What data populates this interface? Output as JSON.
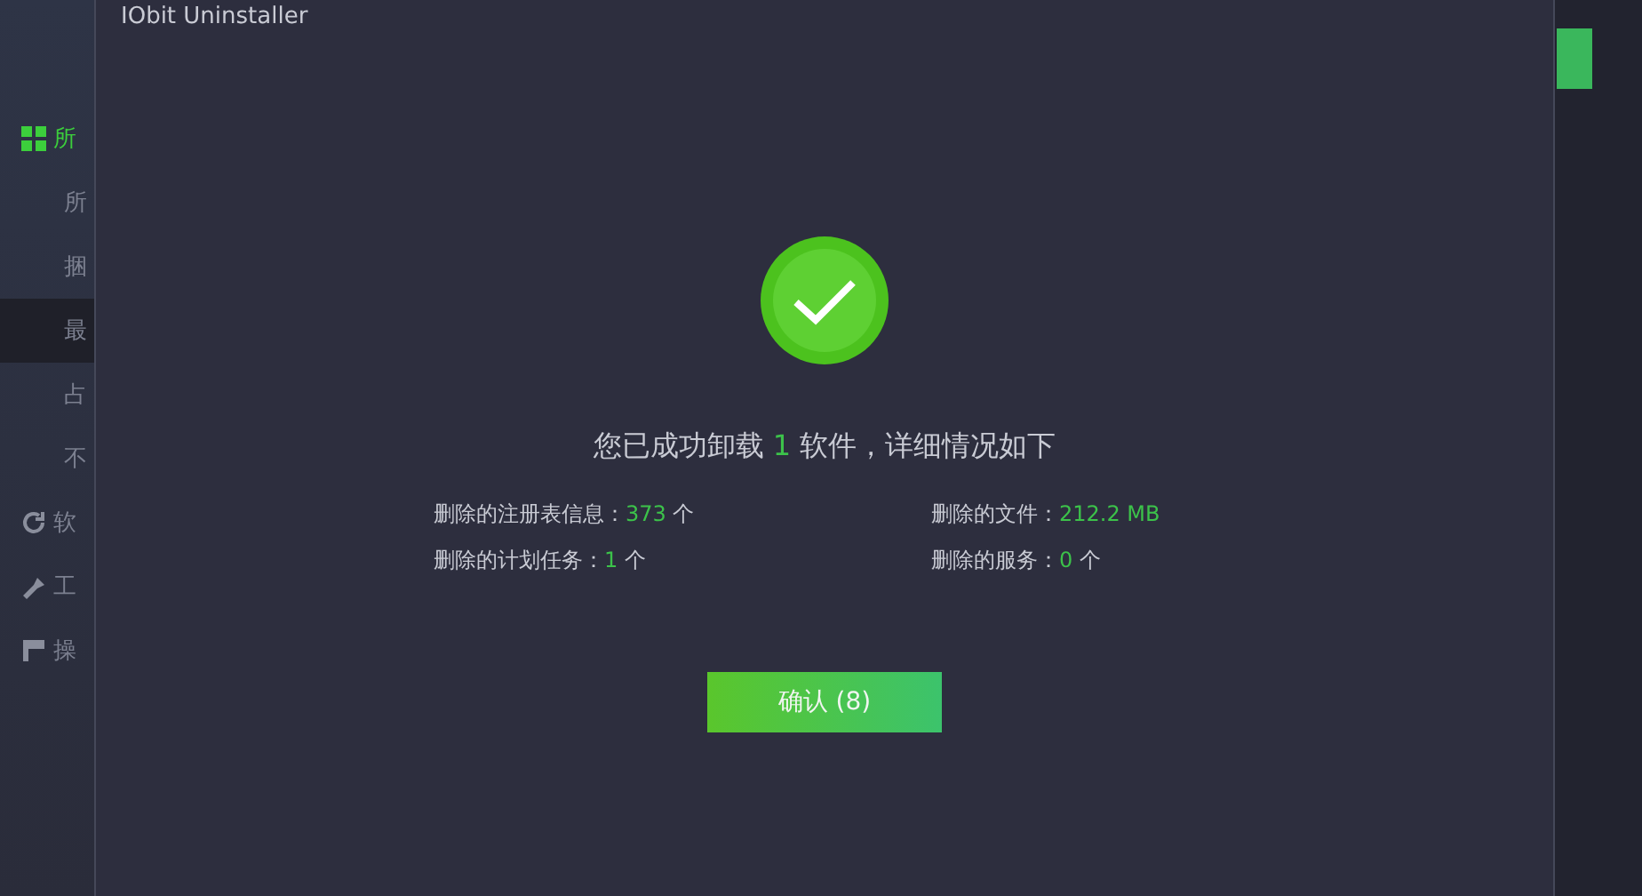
{
  "sidebar": {
    "items": [
      {
        "label": "所",
        "kind": "section",
        "selected": true
      },
      {
        "label": "所",
        "kind": "item",
        "selected": false
      },
      {
        "label": "捆",
        "kind": "item",
        "selected": false
      },
      {
        "label": "最",
        "kind": "item",
        "selected": true
      },
      {
        "label": "占",
        "kind": "item",
        "selected": false
      },
      {
        "label": "不",
        "kind": "item",
        "selected": false
      },
      {
        "label": "软",
        "kind": "section",
        "selected": false
      },
      {
        "label": "工",
        "kind": "section",
        "selected": false
      },
      {
        "label": "操",
        "kind": "section",
        "selected": false
      }
    ]
  },
  "dialog": {
    "title": "IObit Uninstaller",
    "heading": {
      "before": "您已成功卸载",
      "count": "1",
      "after": "软件，详细情况如下"
    },
    "stats": [
      {
        "label": "删除的注册表信息：",
        "value": "373",
        "unit": "个"
      },
      {
        "label": "删除的文件：",
        "value": "212.2 MB"
      },
      {
        "label": "删除的计划任务：",
        "value": "1",
        "unit": "个"
      },
      {
        "label": "删除的服务：",
        "value": "0",
        "unit": "个"
      }
    ],
    "confirm_button": "确认 (8)"
  }
}
